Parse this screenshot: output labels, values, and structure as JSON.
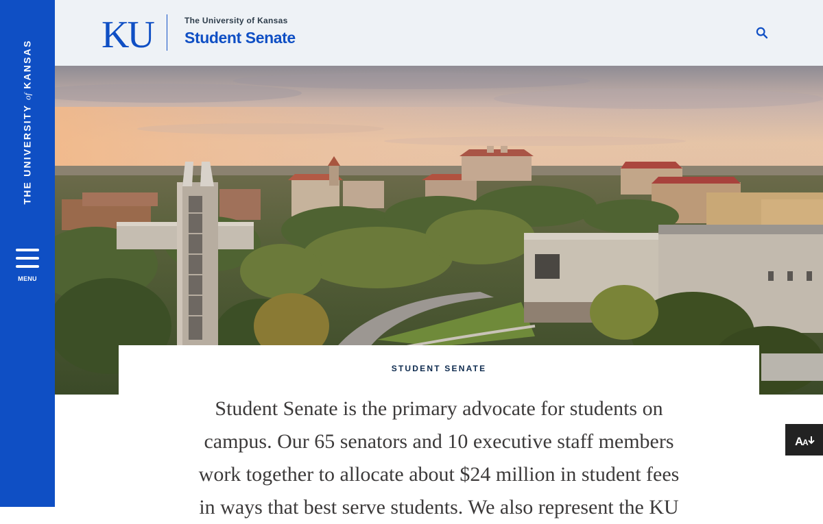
{
  "rail": {
    "wordmark_before": "THE UNIVERSITY ",
    "wordmark_of": "of",
    "wordmark_after": " KANSAS",
    "menu_label": "MENU"
  },
  "header": {
    "logo_text": "KU",
    "subtitle": "The University of Kansas",
    "title": "Student Senate",
    "search_icon": "search-icon"
  },
  "hero": {
    "image_subject": "aerial-campus-photo-at-sunset"
  },
  "content": {
    "eyebrow": "STUDENT SENATE",
    "intro_lines": [
      "Student Senate is the primary advocate for students on",
      "campus. Our 65 senators and 10 executive staff members",
      "work together to allocate about $24 million in student fees",
      "in ways that best serve students. We also represent the KU"
    ]
  },
  "floating_button": {
    "icon": "text-size-icon"
  },
  "colors": {
    "brand_blue": "#0f4fc4",
    "header_bg": "#eef2f6",
    "eyebrow_navy": "#0d2a4e",
    "body_text": "#3c3a3a"
  }
}
